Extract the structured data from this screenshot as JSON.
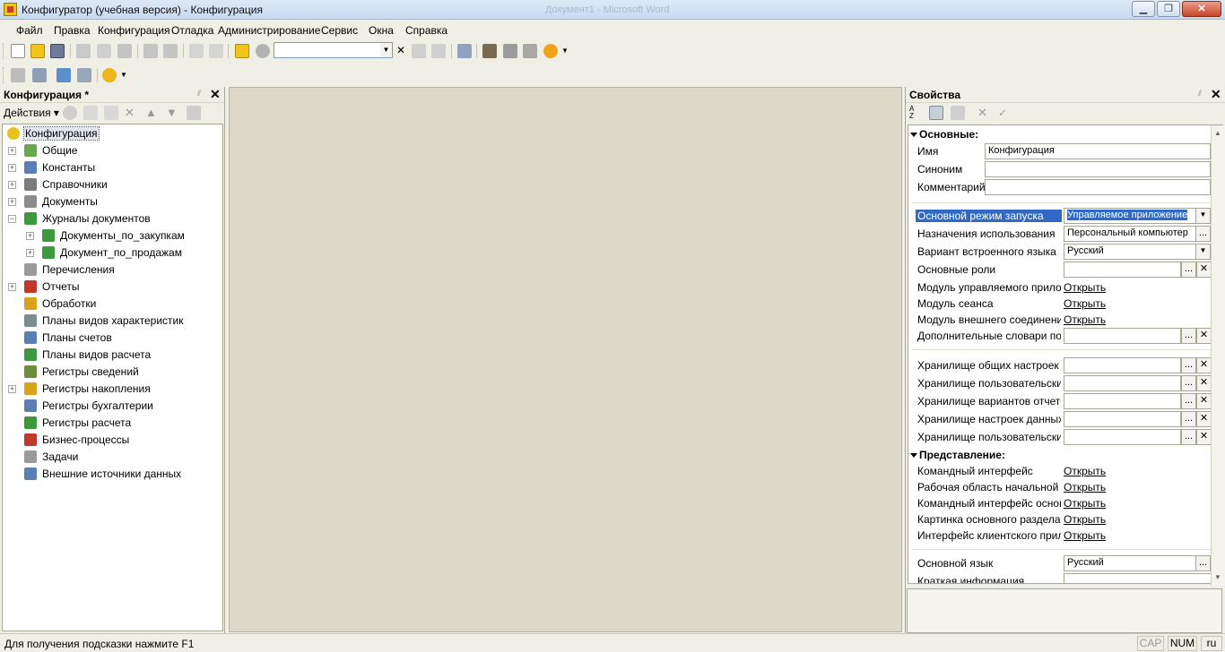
{
  "window": {
    "title": "Конфигуратор (учебная версия) - Конфигурация",
    "background_title": "Документ1 - Microsoft Word",
    "controls": {
      "minimize": "▁",
      "maximize": "❐",
      "close": "✕"
    }
  },
  "menu": {
    "items": [
      "Файл",
      "Правка",
      "Конфигурация",
      "Отладка",
      "Администрирование",
      "Сервис",
      "Окна",
      "Справка"
    ]
  },
  "toolbar": {
    "search_value": "",
    "search_dropdown": "▼",
    "search_clear": "✕"
  },
  "config_panel": {
    "title": "Конфигурация *",
    "pin": "⫽",
    "close": "✕",
    "actions_label": "Действия ▾",
    "tree": [
      {
        "label": "Конфигурация",
        "selected": true,
        "icon": "configuration-icon",
        "color": "#e8c21b"
      },
      {
        "label": "Общие",
        "expander": "+",
        "icon": "common-icon",
        "color": "#6aa84f"
      },
      {
        "label": "Константы",
        "expander": "+",
        "icon": "constants-icon",
        "color": "#5b7fb5"
      },
      {
        "label": "Справочники",
        "expander": "+",
        "icon": "catalogs-icon",
        "color": "#7b7b7b"
      },
      {
        "label": "Документы",
        "expander": "+",
        "icon": "documents-icon",
        "color": "#8c8c8c"
      },
      {
        "label": "Журналы документов",
        "expander": "−",
        "icon": "document-journals-icon",
        "color": "#3c9a3c"
      },
      {
        "label": "Документы_по_закупкам",
        "expander": "+",
        "child": true,
        "icon": "journal-icon",
        "color": "#3c9a3c"
      },
      {
        "label": "Документ_по_продажам",
        "expander": "+",
        "child": true,
        "icon": "journal-icon",
        "color": "#3c9a3c"
      },
      {
        "label": "Перечисления",
        "icon": "enums-icon",
        "color": "#9a9a9a"
      },
      {
        "label": "Отчеты",
        "expander": "+",
        "icon": "reports-icon",
        "color": "#c0392b"
      },
      {
        "label": "Обработки",
        "icon": "data-processors-icon",
        "color": "#d9a21b"
      },
      {
        "label": "Планы видов характеристик",
        "icon": "chart-of-characteristic-types-icon",
        "color": "#7f8c8d"
      },
      {
        "label": "Планы счетов",
        "icon": "chart-of-accounts-icon",
        "color": "#5b7fb5"
      },
      {
        "label": "Планы видов расчета",
        "icon": "chart-of-calculation-types-icon",
        "color": "#3c9a3c"
      },
      {
        "label": "Регистры сведений",
        "icon": "information-registers-icon",
        "color": "#6d8c3c"
      },
      {
        "label": "Регистры накопления",
        "expander": "+",
        "icon": "accumulation-registers-icon",
        "color": "#d9a21b"
      },
      {
        "label": "Регистры бухгалтерии",
        "icon": "accounting-registers-icon",
        "color": "#5b7fb5"
      },
      {
        "label": "Регистры расчета",
        "icon": "calculation-registers-icon",
        "color": "#3c9a3c"
      },
      {
        "label": "Бизнес-процессы",
        "icon": "business-processes-icon",
        "color": "#c0392b"
      },
      {
        "label": "Задачи",
        "icon": "tasks-icon",
        "color": "#9a9a9a"
      },
      {
        "label": "Внешние источники данных",
        "icon": "external-data-sources-icon",
        "color": "#5b7fb5"
      }
    ]
  },
  "properties_panel": {
    "title": "Свойства",
    "pin": "⫽",
    "close": "✕",
    "sections": {
      "main": "Основные:",
      "presentation": "Представление:"
    },
    "fields": {
      "name_label": "Имя",
      "name_value": "Конфигурация",
      "synonym_label": "Синоним",
      "synonym_value": "",
      "comment_label": "Комментарий",
      "comment_value": "",
      "launch_mode_label": "Основной режим запуска",
      "launch_mode_value": "Управляемое приложение",
      "usage_purpose_label": "Назначения использования",
      "usage_purpose_value": "Персональный компьютер",
      "script_variant_label": "Вариант встроенного языка",
      "script_variant_value": "Русский",
      "main_roles_label": "Основные роли",
      "main_roles_value": "",
      "managed_app_module_label": "Модуль управляемого приложе",
      "session_module_label": "Модуль сеанса",
      "ext_connection_module_label": "Модуль внешнего соединения",
      "fulltext_dict_label": "Дополнительные словари полн",
      "common_settings_storage_label": "Хранилище общих настроек",
      "user_settings_storage_label": "Хранилище пользовательских н",
      "report_variants_storage_label": "Хранилище вариантов отчетов",
      "form_data_settings_storage_label": "Хранилище настроек данных фо",
      "user_report_settings_storage_label": "Хранилище пользовательских н",
      "command_interface_label": "Командный интерфейс",
      "home_page_label": "Рабочая область начальной стр",
      "main_section_ci_label": "Командный интерфейс основно",
      "main_section_picture_label": "Картинка основного раздела",
      "client_interface_label": "Интерфейс клиентского прилож",
      "default_language_label": "Основной язык",
      "default_language_value": "Русский",
      "brief_info_label": "Краткая информация"
    },
    "open_link": "Открыть",
    "ellipsis": "...",
    "clear": "✕",
    "dropdown": "▼"
  },
  "statusbar": {
    "hint": "Для получения подсказки нажмите F1",
    "caps": "CAP",
    "num": "NUM",
    "lang": "ru"
  }
}
